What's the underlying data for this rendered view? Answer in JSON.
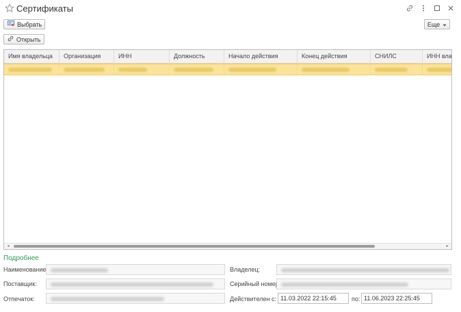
{
  "window": {
    "title": "Сертификаты",
    "star_icon": "star-outline-icon",
    "link_icon": "link-icon",
    "menu_icon": "more-vertical-icon",
    "maximize_icon": "maximize-icon",
    "close_icon": "close-icon"
  },
  "toolbar": {
    "select_label": "Выбрать",
    "open_label": "Открыть",
    "more_label": "Еще"
  },
  "table": {
    "columns": [
      "Имя владельца",
      "Организация",
      "ИНН",
      "Должность",
      "Начало действия",
      "Конец действия",
      "СНИЛС",
      "ИНН владельца"
    ]
  },
  "details": {
    "section_title": "Подробнее",
    "name_label": "Наименование:",
    "supplier_label": "Поставщик:",
    "thumbprint_label": "Отпечаток:",
    "owner_label": "Владелец:",
    "serial_label": "Серийный номер:",
    "valid_from_label": "Действителен с:",
    "valid_from_value": "11.03.2022 22:15:45",
    "valid_to_label": "по:",
    "valid_to_value": "11.06.2023 22:25:45"
  },
  "colors": {
    "selected_row": "#fbe49a",
    "section_title": "#2a9b53"
  }
}
